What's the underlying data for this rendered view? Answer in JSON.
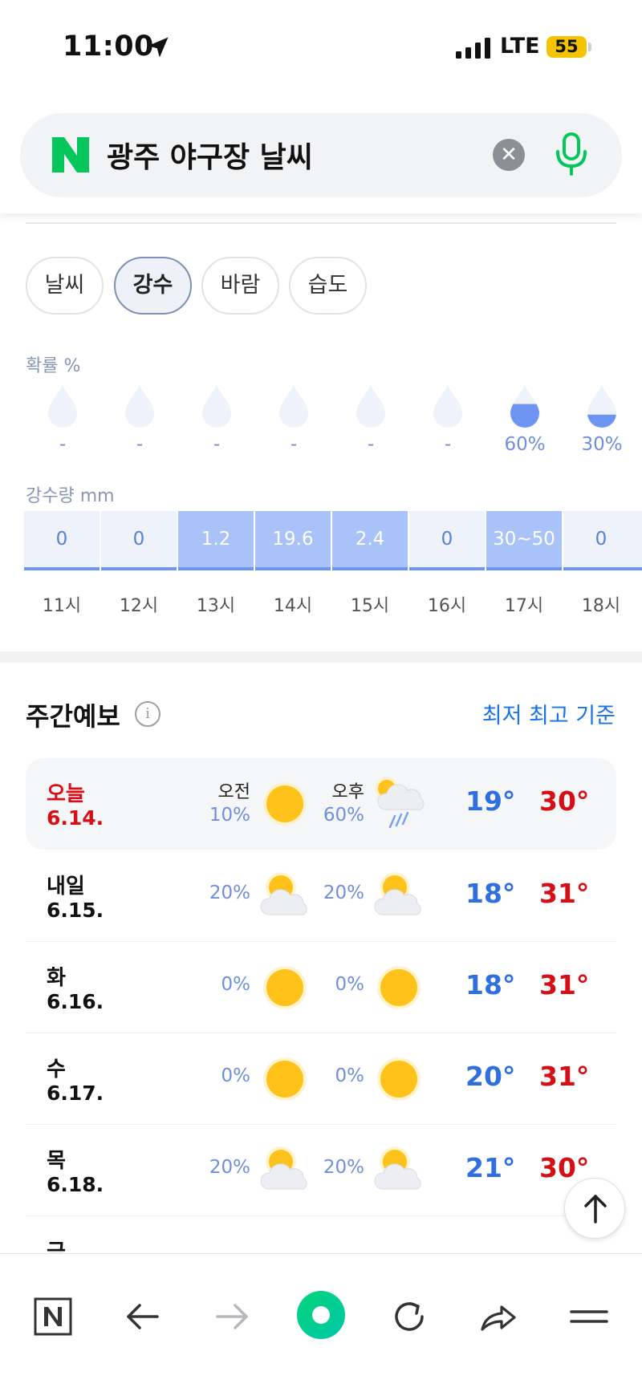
{
  "status_bar": {
    "time": "11:00",
    "network": "LTE",
    "battery": "55"
  },
  "search": {
    "query": "광주 야구장 날씨"
  },
  "tabs": [
    {
      "label": "날씨",
      "active": false
    },
    {
      "label": "강수",
      "active": true
    },
    {
      "label": "바람",
      "active": false
    },
    {
      "label": "습도",
      "active": false
    }
  ],
  "precip": {
    "prob_label": "확률 %",
    "amount_label": "강수량 mm",
    "hours": [
      {
        "hour": "11시",
        "prob": "-",
        "prob_value": 0,
        "amount": "0"
      },
      {
        "hour": "12시",
        "prob": "-",
        "prob_value": 0,
        "amount": "0"
      },
      {
        "hour": "13시",
        "prob": "-",
        "prob_value": 0,
        "amount": "1.2"
      },
      {
        "hour": "14시",
        "prob": "-",
        "prob_value": 0,
        "amount": "19.6"
      },
      {
        "hour": "15시",
        "prob": "-",
        "prob_value": 0,
        "amount": "2.4"
      },
      {
        "hour": "16시",
        "prob": "-",
        "prob_value": 0,
        "amount": "0"
      },
      {
        "hour": "17시",
        "prob": "60%",
        "prob_value": 60,
        "amount": "30~50"
      },
      {
        "hour": "18시",
        "prob": "30%",
        "prob_value": 30,
        "amount": "0"
      }
    ]
  },
  "weekly": {
    "title": "주간예보",
    "link": "최저 최고 기준",
    "am_label": "오전",
    "pm_label": "오후",
    "days": [
      {
        "name": "오늘",
        "date": "6.14.",
        "am_pct": "10%",
        "am_icon": "sun-icon",
        "pm_pct": "60%",
        "pm_icon": "rain-cloud-icon",
        "min": "19°",
        "max": "30°",
        "today": true
      },
      {
        "name": "내일",
        "date": "6.15.",
        "am_pct": "20%",
        "am_icon": "partly-cloudy-icon",
        "pm_pct": "20%",
        "pm_icon": "partly-cloudy-icon",
        "min": "18°",
        "max": "31°"
      },
      {
        "name": "화",
        "date": "6.16.",
        "am_pct": "0%",
        "am_icon": "sun-icon",
        "pm_pct": "0%",
        "pm_icon": "sun-icon",
        "min": "18°",
        "max": "31°"
      },
      {
        "name": "수",
        "date": "6.17.",
        "am_pct": "0%",
        "am_icon": "sun-icon",
        "pm_pct": "0%",
        "pm_icon": "sun-icon",
        "min": "20°",
        "max": "31°"
      },
      {
        "name": "목",
        "date": "6.18.",
        "am_pct": "20%",
        "am_icon": "partly-cloudy-icon",
        "pm_pct": "20%",
        "pm_icon": "partly-cloudy-icon",
        "min": "21°",
        "max": "30°"
      }
    ]
  },
  "colors": {
    "accent_green": "#03c75a",
    "temp_min": "#2f6fe0",
    "temp_max": "#d60e16",
    "rain_blue": "#6e95f2"
  }
}
